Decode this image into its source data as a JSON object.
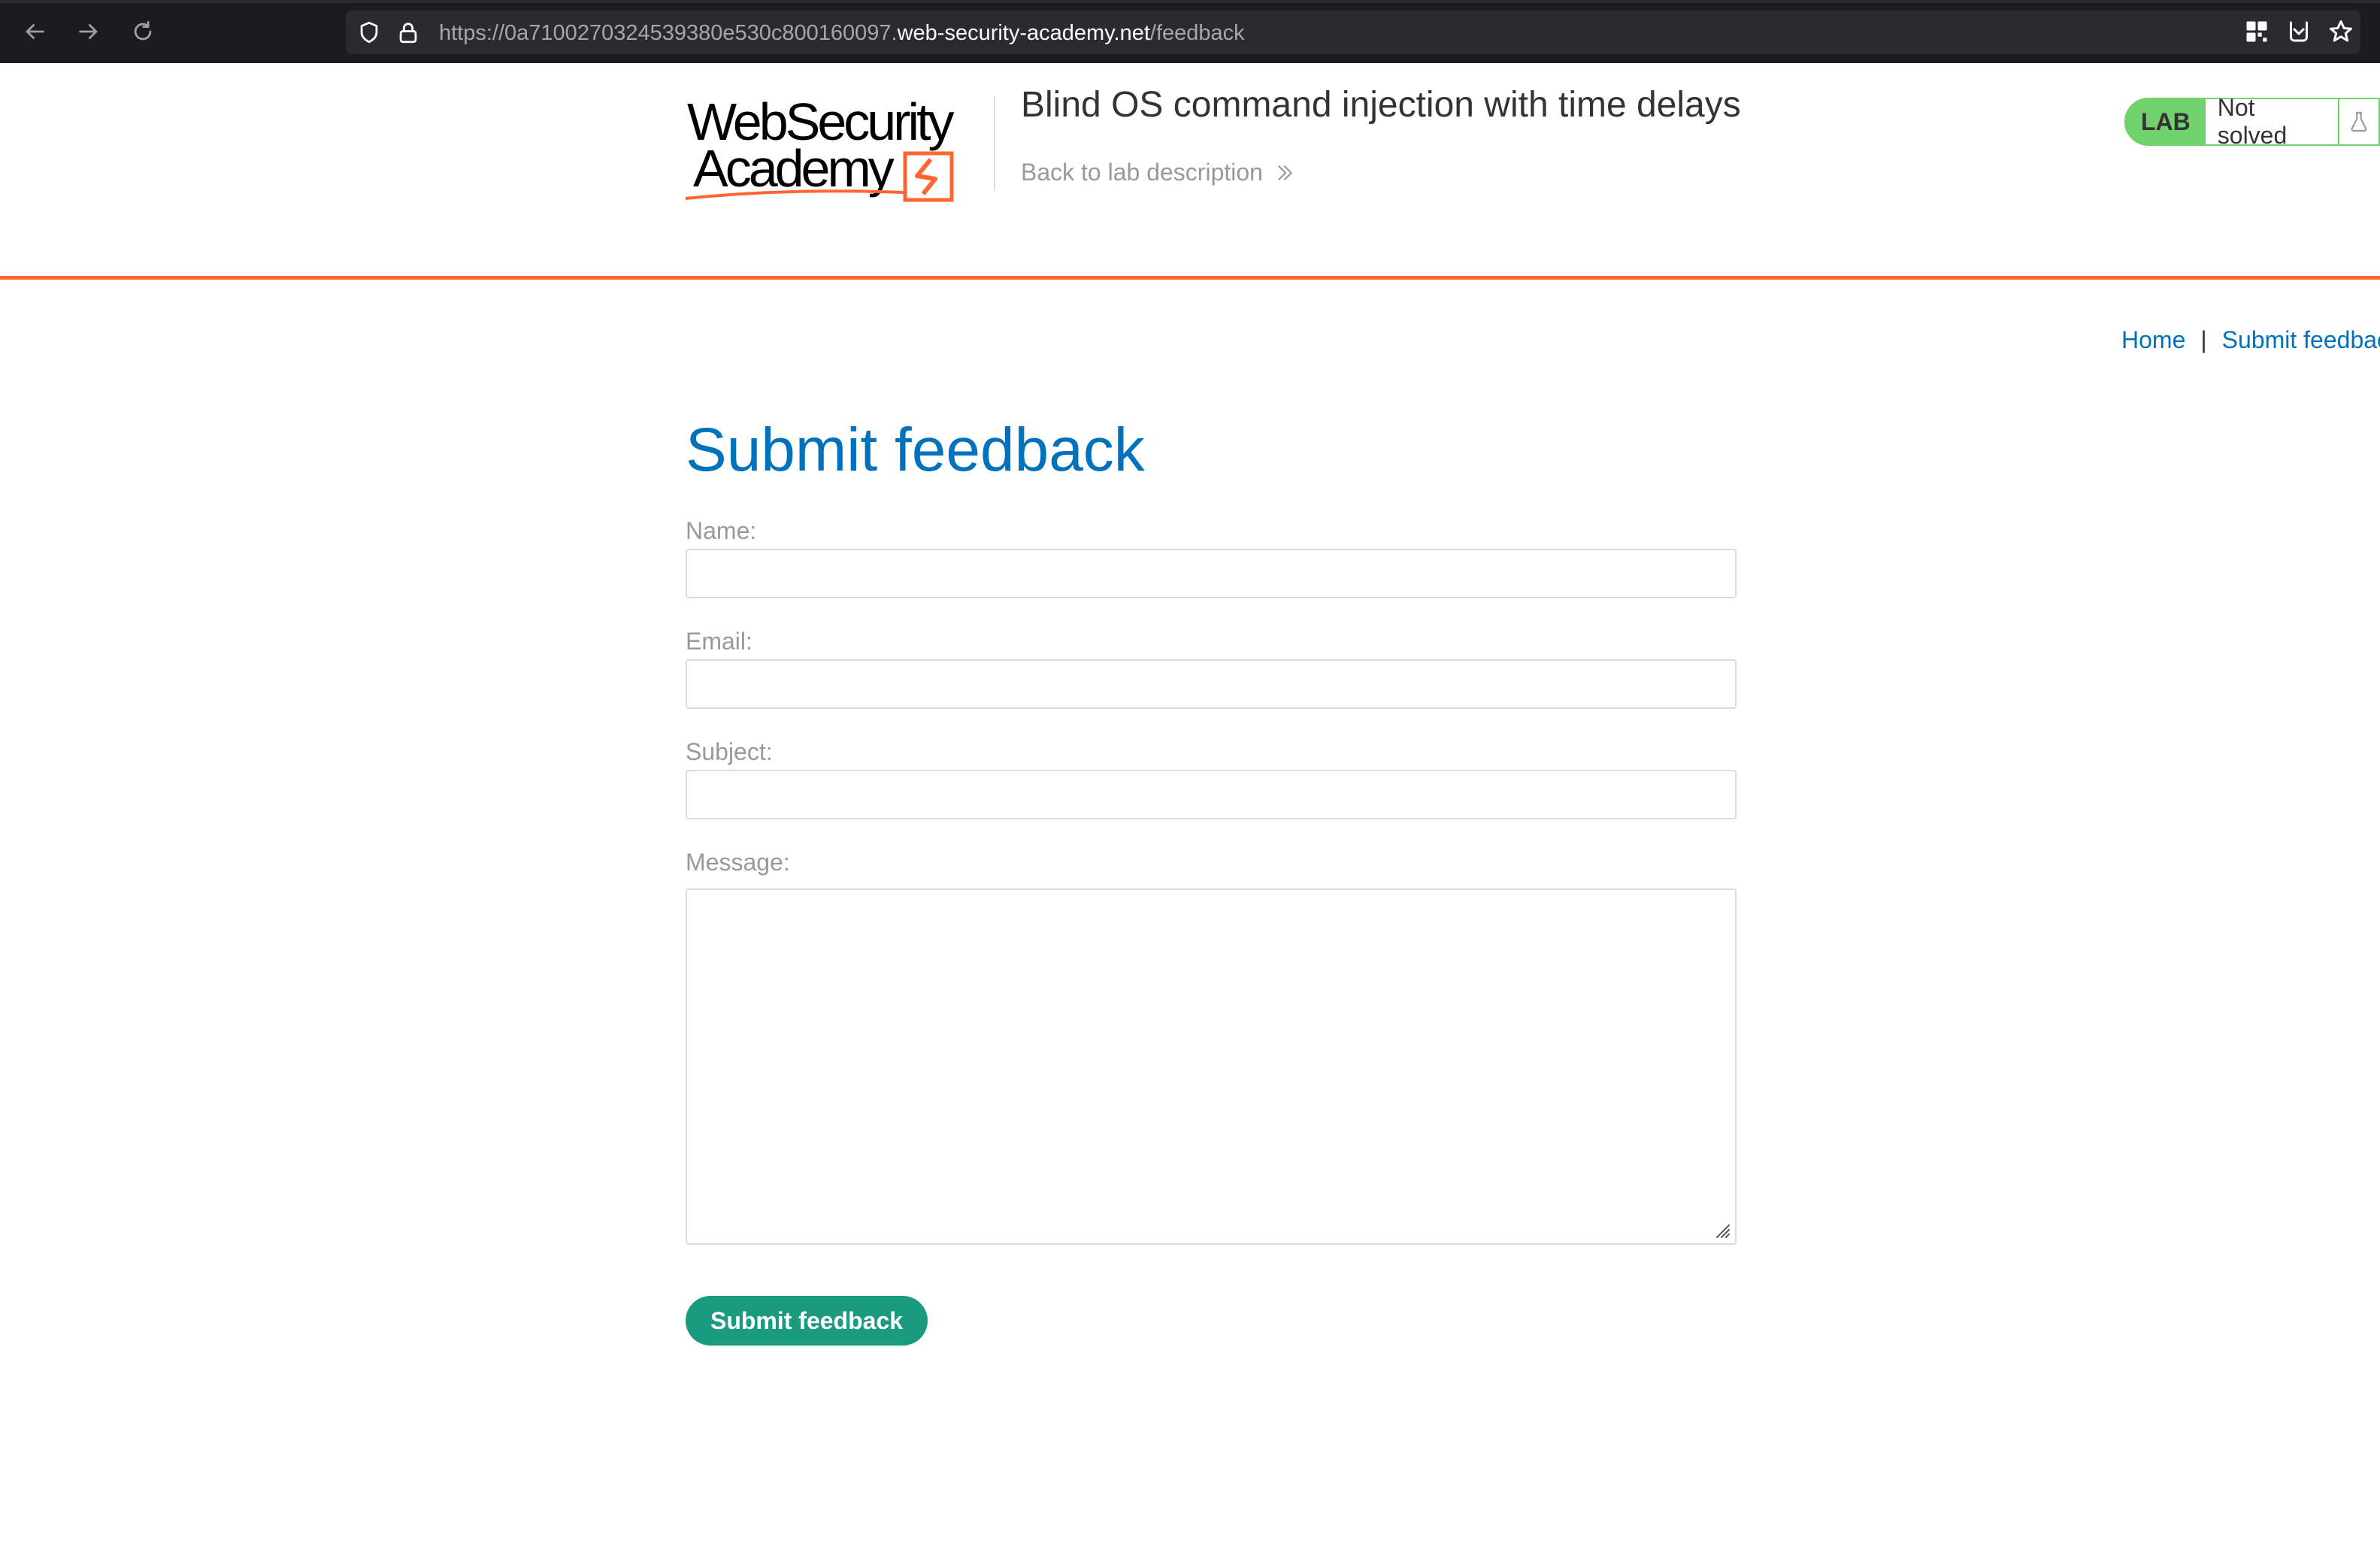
{
  "browser": {
    "url_prefix": "https://0a7100270324539380e530c800160097.",
    "url_host": "web-security-academy.net",
    "url_path": "/feedback"
  },
  "header": {
    "logo_line1": "WebSecurity",
    "logo_line2": "Academy",
    "lab_title": "Blind OS command injection with time delays",
    "back_link": "Back to lab description",
    "lab_badge": "LAB",
    "status": "Not solved"
  },
  "breadcrumb": {
    "home": "Home",
    "separator": "|",
    "current": "Submit feedback"
  },
  "form": {
    "heading": "Submit feedback",
    "name_label": "Name:",
    "email_label": "Email:",
    "subject_label": "Subject:",
    "message_label": "Message:",
    "name_value": "",
    "email_value": "",
    "subject_value": "",
    "message_value": "",
    "submit_label": "Submit feedback"
  },
  "colors": {
    "accent_orange": "#ff6633",
    "heading_blue": "#0071bc",
    "submit_green": "#1a9a7f",
    "badge_green": "#70d16d"
  }
}
